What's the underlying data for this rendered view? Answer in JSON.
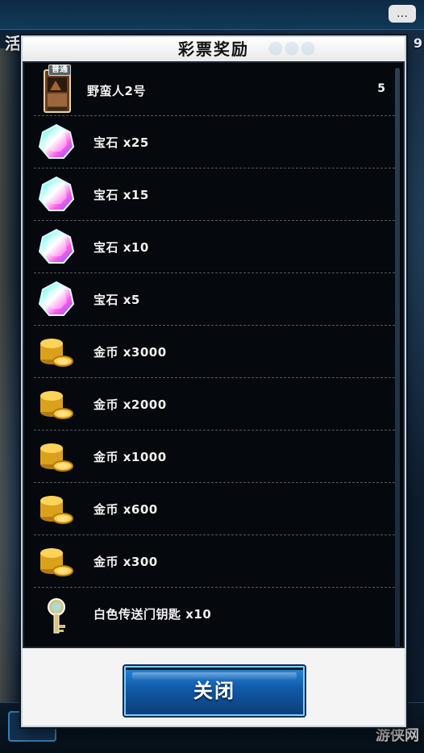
{
  "background": {
    "title": "活动",
    "right_count": "9",
    "chat_icon": "chat-bubble-icon",
    "back_icon": "back-arrow-icon"
  },
  "modal": {
    "title": "彩票奖励",
    "close_label": "关闭"
  },
  "rewards": [
    {
      "type": "card",
      "badge": "普通",
      "label": "野蛮人2号",
      "count": "5",
      "icon": "monster-card-icon"
    },
    {
      "type": "gem",
      "label": "宝石 x25",
      "icon": "gem-icon"
    },
    {
      "type": "gem",
      "label": "宝石 x15",
      "icon": "gem-icon"
    },
    {
      "type": "gem",
      "label": "宝石 x10",
      "icon": "gem-icon"
    },
    {
      "type": "gem",
      "label": "宝石 x5",
      "icon": "gem-icon"
    },
    {
      "type": "coin",
      "label": "金币 x3000",
      "icon": "gold-coin-stack-icon"
    },
    {
      "type": "coin",
      "label": "金币 x2000",
      "icon": "gold-coin-stack-icon"
    },
    {
      "type": "coin",
      "label": "金币 x1000",
      "icon": "gold-coin-stack-icon"
    },
    {
      "type": "coin",
      "label": "金币 x600",
      "icon": "gold-coin-stack-icon"
    },
    {
      "type": "coin",
      "label": "金币 x300",
      "icon": "gold-coin-stack-icon"
    },
    {
      "type": "key",
      "label": "白色传送门钥匙 x10",
      "icon": "white-portal-key-icon"
    }
  ],
  "watermark": "游侠网",
  "colors": {
    "panel": "#05080c",
    "modal_bg": "#f4f4f4",
    "button_top": "#2b86d8",
    "button_bottom": "#0b3e7b",
    "gold": "#d9a11c"
  }
}
